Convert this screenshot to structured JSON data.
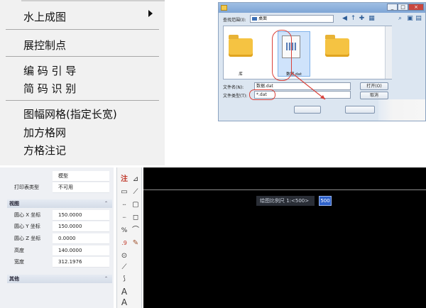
{
  "context_menu": {
    "items": [
      "水上成图",
      "展控制点",
      "编 码 引 导",
      "简 码 识 别",
      "图幅网格(指定长宽)",
      "加方格网",
      "方格注记"
    ]
  },
  "file_dialog": {
    "title": "",
    "look_in_label": "查找范围(I):",
    "look_in_value": "桌面",
    "files": [
      {
        "name": "库",
        "icon": "library-folder-icon"
      },
      {
        "name": "数据.dat",
        "icon": "dat-file-icon",
        "selected": true
      },
      {
        "name": "",
        "icon": "folder-icon"
      }
    ],
    "filename_label": "文件名(N):",
    "filename_value": "数据.dat",
    "filetype_label": "文件类型(T):",
    "filetype_value": "*.dat",
    "open_button": "打开(O)",
    "cancel_button": "取消",
    "locate_button": "",
    "find_button": "",
    "window_buttons": [
      "_",
      "□",
      "×"
    ]
  },
  "property_panel": {
    "top_rows": [
      {
        "key": "",
        "value": "模型"
      },
      {
        "key": "打印表类型",
        "value": "不可用"
      }
    ],
    "sections": [
      {
        "title": "视图",
        "rows": [
          {
            "key": "圆心 X 坐标",
            "value": "150.0000"
          },
          {
            "key": "圆心 Y 坐标",
            "value": "150.0000"
          },
          {
            "key": "圆心 Z 坐标",
            "value": "0.0000"
          },
          {
            "key": "高度",
            "value": "140.0000"
          },
          {
            "key": "宽度",
            "value": "312.1976"
          }
        ]
      },
      {
        "title": "其他",
        "rows": []
      }
    ]
  },
  "toolbar": {
    "tools": [
      {
        "label": "注",
        "icon": "annotate-icon"
      },
      {
        "label": "",
        "icon": "arc-icon"
      },
      {
        "label": "",
        "icon": "rectangle-icon"
      },
      {
        "label": "",
        "icon": "dashed-line-icon"
      },
      {
        "label": "",
        "icon": "dotted-line-icon"
      },
      {
        "label": "",
        "icon": "percent-icon"
      },
      {
        "label": "",
        "icon": "circle-dot-icon"
      },
      {
        "label": "",
        "icon": "diagonal-line-icon"
      },
      {
        "label": "",
        "icon": "chain-icon"
      },
      {
        "label": "A",
        "icon": "text-icon"
      },
      {
        "label": "A",
        "icon": "text-edit-icon"
      }
    ]
  },
  "canvas": {
    "scale_prompt": "绘图比例尺 1:<500>",
    "scale_value": "500"
  },
  "colors": {
    "menu_bg": "#f1f1f1",
    "dialog_bg": "#dce6f1",
    "highlight_red": "#d9413a",
    "canvas_bg": "#000000",
    "input_selection": "#2f62c9"
  }
}
